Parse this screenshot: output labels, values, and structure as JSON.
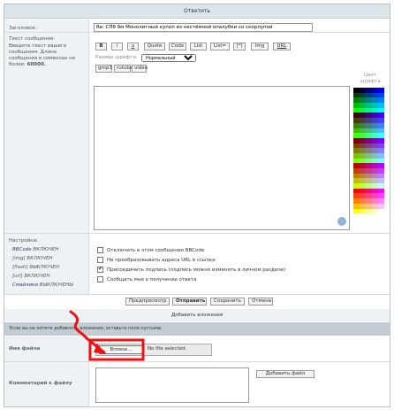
{
  "form": {
    "title": "Ответить",
    "subject_label": "Заголовок:",
    "subject_value": "Re: СПб 9м Монолитный купол из нестёмной опалубки со скорлупой",
    "message_label": "Текст сообщения:",
    "message_hint": "Введите текст вашего сообщения. Длина сообщения в символах не более:",
    "message_limit": "60000.",
    "font_color_label": "Цвет шрифта",
    "font_size_label": "Размер шрифта:",
    "font_size_value": "Нормальный"
  },
  "toolbar": {
    "row1": [
      "B",
      "i",
      "u",
      "Quote",
      "Code",
      "List",
      "List=",
      "[*]",
      "Img",
      "URL"
    ],
    "row2": [
      "gmp3",
      "rutube",
      "video"
    ]
  },
  "palette": {
    "colors": [
      "#000000",
      "#000040",
      "#000080",
      "#0000bf",
      "#0000ff",
      "#004000",
      "#004040",
      "#004080",
      "#0040bf",
      "#0040ff",
      "#008000",
      "#008040",
      "#008080",
      "#0080bf",
      "#0080ff",
      "#00bf00",
      "#00bf40",
      "#00bf80",
      "#00bfbf",
      "#00bfff",
      "#00ff00",
      "#00ff40",
      "#00ff80",
      "#00ffbf",
      "#00ffff",
      "#400000",
      "#400040",
      "#400080",
      "#4000bf",
      "#4000ff",
      "#404000",
      "#404040",
      "#404080",
      "#4040bf",
      "#4040ff",
      "#408000",
      "#408040",
      "#408080",
      "#4080bf",
      "#4080ff",
      "#40bf00",
      "#40bf40",
      "#40bf80",
      "#40bfbf",
      "#40bfff",
      "#40ff00",
      "#40ff40",
      "#40ff80",
      "#40ffbf",
      "#40ffff",
      "#800000",
      "#800040",
      "#800080",
      "#8000bf",
      "#8000ff",
      "#804000",
      "#804040",
      "#804080",
      "#8040bf",
      "#8040ff",
      "#808000",
      "#808040",
      "#808080",
      "#8080bf",
      "#8080ff",
      "#80bf00",
      "#80bf40",
      "#80bf80",
      "#80bfbf",
      "#80bfff",
      "#80ff00",
      "#80ff40",
      "#80ff80",
      "#80ffbf",
      "#80ffff",
      "#bf0000",
      "#bf0040",
      "#bf0080",
      "#bf00bf",
      "#bf00ff",
      "#bf4000",
      "#bf4040",
      "#bf4080",
      "#bf40bf",
      "#bf40ff",
      "#bf8000",
      "#bf8040",
      "#bf8080",
      "#bf80bf",
      "#bf80ff",
      "#bfbf00",
      "#bfbf40",
      "#bfbf80",
      "#bfbfbf",
      "#bfbfff",
      "#bfff00",
      "#bfff40",
      "#bfff80",
      "#bfffbf",
      "#bfffff",
      "#ff0000",
      "#ff0040",
      "#ff0080",
      "#ff00bf",
      "#ff00ff",
      "#ff4000",
      "#ff4040",
      "#ff4080",
      "#ff40bf",
      "#ff40ff",
      "#ff8000",
      "#ff8040",
      "#ff8080",
      "#ff80bf",
      "#ff80ff",
      "#ffbf00",
      "#ffbf40",
      "#ffbf80",
      "#ffbfbf",
      "#ffbfff",
      "#ffff00",
      "#ffff40",
      "#ffff80",
      "#ffffbf",
      "#ffffff"
    ]
  },
  "settings": {
    "label": "Настройки:",
    "status": [
      {
        "name": "BBCode",
        "state": "ВКЛЮЧЕН"
      },
      {
        "name": "[img]",
        "state": "ВКЛЮЧЕН"
      },
      {
        "name": "[flash]",
        "state": "ВЫКЛЮЧЕН"
      },
      {
        "name": "[url]",
        "state": "ВКЛЮЧЕН"
      },
      {
        "name": "Смайлики",
        "state": "ВЫКЛЮЧЕНЫ"
      }
    ],
    "options": [
      {
        "label": "Отключить в этом сообщении BBCode",
        "checked": false
      },
      {
        "label": "Не преобразовывать адреса URL в ссылки",
        "checked": false
      },
      {
        "label": "Присоединить подпись (подпись можно изменять в личном разделе)",
        "checked": true
      },
      {
        "label": "Сообщать мне о получении ответа",
        "checked": false
      }
    ]
  },
  "buttons": {
    "preview": "Предпросмотр",
    "submit": "Отправить",
    "save": "Сохранить",
    "cancel": "Отмена"
  },
  "attachments": {
    "title": "Добавить вложения",
    "hint": "Если вы не хотите добавлять вложения, оставьте поля пустыми.",
    "file_label": "Имя файла",
    "browse_label": "Browse...",
    "no_file_text": "No file selected.",
    "comment_label": "Комментарий к файлу",
    "add_file_button": "Добавить файл"
  },
  "colors": {
    "annotation_red": "#ee1111",
    "header_bg": "#dde4ea",
    "bar_bg": "#c3ccd3"
  }
}
